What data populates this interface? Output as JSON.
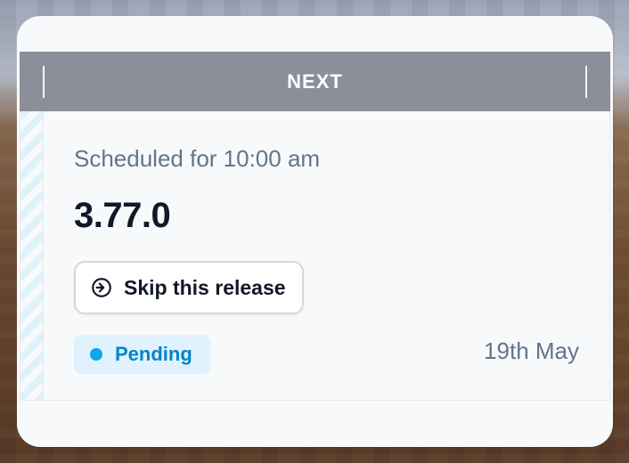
{
  "card": {
    "header_label": "NEXT",
    "scheduled_text": "Scheduled for 10:00 am",
    "version": "3.77.0",
    "skip_button_label": "Skip this release",
    "status_label": "Pending",
    "date_label": "19th May"
  },
  "icons": {
    "skip": "arrow-right-circle-icon",
    "status": "status-dot-icon"
  },
  "colors": {
    "header_bg": "#8c8f99",
    "status_bg": "#e0f2fe",
    "status_dot": "#0ea5e9",
    "status_text": "#0284c7"
  }
}
